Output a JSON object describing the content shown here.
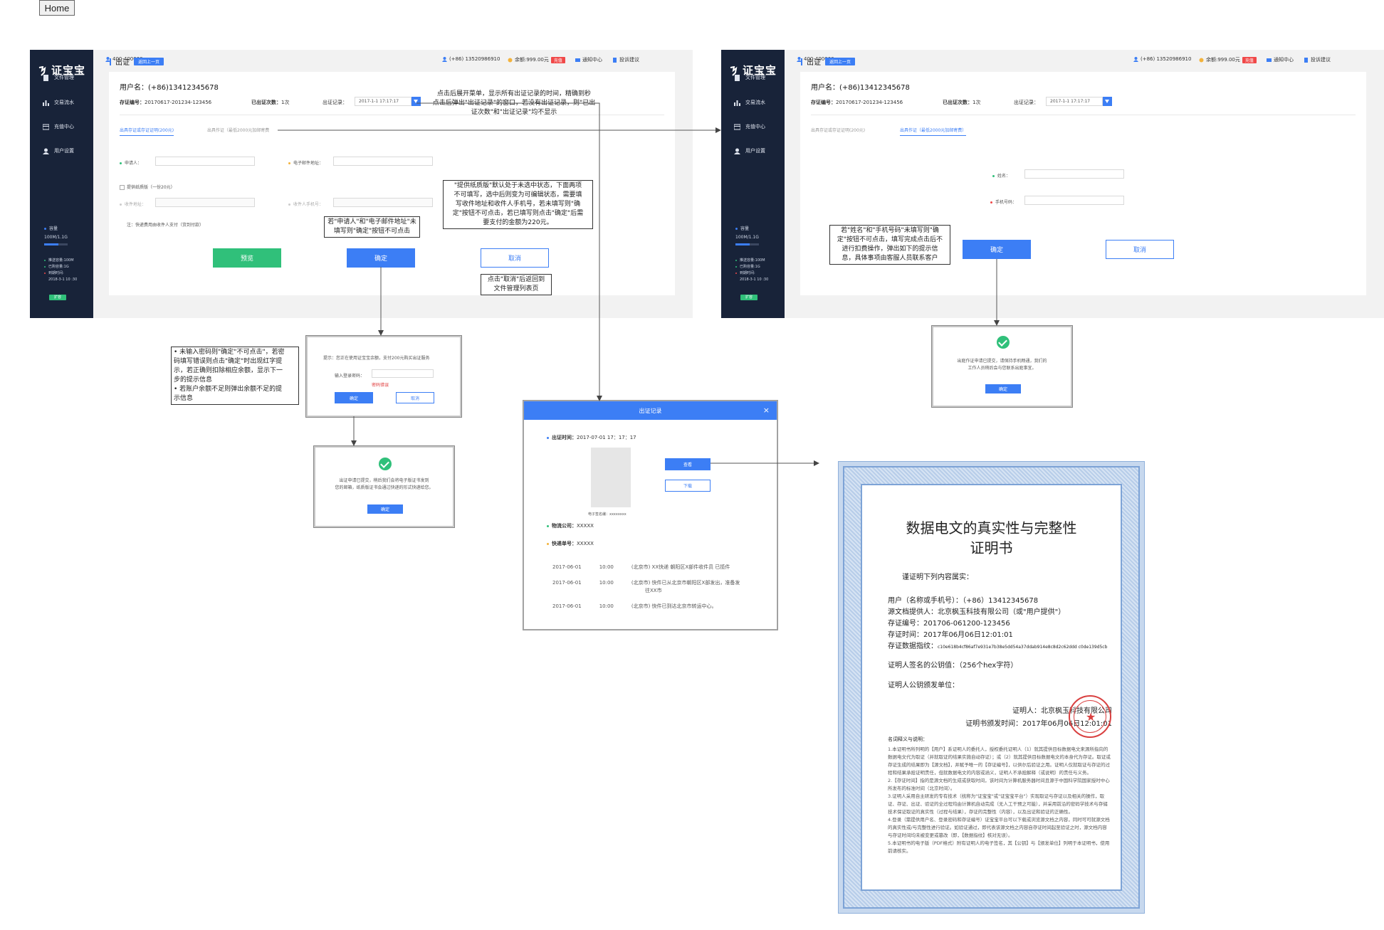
{
  "home_label": "Home",
  "brand": "证宝宝",
  "sidebar": {
    "items": [
      "文件管理",
      "交易流水",
      "充值中心",
      "用户设置"
    ],
    "capacity_label": "容量",
    "capacity_value": "100M/1.1G",
    "stats": [
      "推送容量:100M",
      "已购容量:1G",
      "到期时间:",
      "2018-3-1 10 :30"
    ],
    "expand_btn": "扩容"
  },
  "topbar": {
    "phone": "400-400000",
    "user": "(+86) 13520986910",
    "balance": "余额:999.00元",
    "recharge": "充值",
    "notify": "通知中心",
    "feedback": "投诉建议"
  },
  "page": {
    "crumb_title": "出证",
    "back_btn": "返回上一页",
    "username_line": "用户名：(+86)13412345678",
    "save_no_label": "存证编号：",
    "save_no": "20170617-201234-123456",
    "count_label": "已出证次数：",
    "count": "1次",
    "record_label": "出证记录：",
    "record_value": "2017-1-1  17:17:17"
  },
  "left_screen": {
    "tab_active": "出具存证或存证证明(200元)",
    "tab_inactive": "出具作证（最低2000元加邮寄费",
    "applicant_label": "申请人：",
    "email_label": "电子邮件地址：",
    "paper_label": "提供纸质版（一份20元）",
    "recv_addr_label": "收件地址：",
    "recv_phone_label": "收件人手机号：",
    "notice": "注：快递费用由收件人支付（货到付款）",
    "preview_btn": "预览",
    "ok_btn": "确定",
    "cancel_btn": "取消"
  },
  "right_screen": {
    "tab_inactive": "出具存证或存证证明(200元)",
    "tab_active": "出具作证（最低2000元加邮寄费）",
    "name_label": "姓名：",
    "phone_label": "手机号码：",
    "ok_btn": "确定",
    "cancel_btn": "取消"
  },
  "notes": {
    "record_dropdown": "点击后展开菜单，显示所有出证记录的时间，精确到秒\n点击后弹出\"出证记录\"的窗口，若没有出证记录，则\"已出\n证次数\"和\"出证记录\"均不显示",
    "paper_default": "\"提供纸质版\"默认处于未选中状态，下面两项\n不可填写，选中后则变为可编辑状态，需要填\n写收件地址和收件人手机号，若未填写则\"确\n定\"按钮不可点击，若已填写则点击\"确定\"后需\n要支付的金额为220元。",
    "applicant_required": "若\"申请人\"和\"电子邮件地址\"未\n填写则\"确定\"按钮不可点击",
    "cancel_back": "点击\"取消\"后返回到\n文件管理列表页",
    "password": "• 未输入密码则\"确定\"不可点击\"，若密\n码填写错误则点击\"确定\"时出现红字提\n示，若正确则扣除相应余额，显示下一\n步的提示信息\n• 若账户余额不足则弹出余额不足的提\n示信息",
    "name_required": "若\"姓名\"和\"手机号码\"未填写则\"确\n定\"按钮不可点击，填写完成点击后不\n进行扣费操作，弹出如下的提示信\n息，具体事项由客服人员联系客户"
  },
  "pay_modal": {
    "tip": "提示：您正在使用证宝宝余额，支付200元购买出证服务",
    "pwd_label": "输入登录密码：",
    "error": "密码错误",
    "ok": "确定",
    "cancel": "取消"
  },
  "success_modal_left": {
    "text": "出证申请已提交，稍后我们会将电子版证书发到\n您的邮箱，纸质版证书会通过快递的形式快递给您。",
    "ok": "确定"
  },
  "success_modal_right": {
    "text": "出庭作证申请已提交，请保持手机畅通，我们的\n工作人员稍后会与您联系出庭事宜。",
    "ok": "确定"
  },
  "record_popup": {
    "title": "出证记录",
    "time_label": "出证时间：",
    "time_value": "2017-07-01   17：17：17",
    "view_btn": "查看",
    "download_btn": "下载",
    "esig_label": "电子签名编：",
    "esig_value": "xxxxxxxx",
    "logistics_label": "物流公司：",
    "logistics_value": "XXXXX",
    "tracking_label": "快递单号：",
    "tracking_value": "XXXXX",
    "logs": [
      {
        "date": "2017-06-01",
        "time": "10:00",
        "text": "(北京市) XX快递     朝阳区X部件收件员   已揽件"
      },
      {
        "date": "2017-06-01",
        "time": "10:00",
        "text": "(北京市) 快件已从北京市朝阳区X部发出，准备发"
      },
      {
        "date": "",
        "time": "",
        "text": "往XX市"
      },
      {
        "date": "2017-06-01",
        "time": "10:00",
        "text": "(北京市) 快件已到达北京市转运中心。"
      }
    ]
  },
  "certificate": {
    "title_line1": "数据电文的真实性与完整性",
    "title_line2": "证明书",
    "intro": "谨证明下列内容属实：",
    "user": "用户（名称或手机号）：（+86）13412345678",
    "source": "源文档提供人：北京枫玉科技有限公司（或\"用户提供\"）",
    "save_no": "存证编号：201706-061200-123456",
    "save_time": "存证时间：2017年06月06日12:01:01",
    "fingerprint_label": "存证数据指纹：",
    "fingerprint": "c10e618b4cf86af7e931e7b38e5dd54a37ddab914e8c8d2c62ddd c0de139d5cb",
    "pubkey": "证明人签名的公钥值：（256个hex字符）",
    "issuer": "证明人公钥颁发单位：",
    "prover": "证明人：北京枫玉科技有限公司",
    "issue_time": "证明书颁发时间：2017年06月06日12:01:01",
    "terms_title": "名词释义与说明：",
    "terms": "1.本证明书所列明的【用户】系证明人的委托人，授权委托证明人（1）就其提供目标数据电文来源所指向的数据电文代为取证（并就取证的结果实施自动存证）；或（2）就其提供目标数据电文的本身代为存证。取证或存证生成的结果即为【源文档】，并赋予唯一的【存证编号】，以供尔后验证之用。证明人仅就取证与存证的过程和结果承担证明责任，但就数据电文的内容或涵义，证明人不承担解释（或说明）的责任与义务。\n2.【存证时间】指的是源文档的生成或获取时间，该时间为计算机服务器时间且源于中国科学院国家授时中心所发布的标准时间（北京时间）。\n3.证明人采用自主研发的专有技术（统称为\"证宝宝\"或\"证宝宝平台\"）实现取证与存证以及相关的操作，取证、存证、出证、验证的全过程均由计算机自动完成（无人工干预之可能），并采用前沿的密码学技术与存储技术保证取证的真实性（过程与结果），存证的完整性（内容），以及出证和验证的正确性。\n4.登录（需提供用户名、登录密码和存证编号）证宝宝平台可以下载或浏览源文档之内容，同时可可就源文档的真实性或/与完整性进行验证。如验证通过，即代表该源文档之内容自存证时间起至验证之时，源文档内容与存证时间均未被变更或篡改（即，【数据指纹】核对无误）。\n5.本证明书的电子版（PDF格式）附有证明人的电子签名，其【公钥】与【颁发单位】列明于本证明书，使用前请核实。"
  }
}
